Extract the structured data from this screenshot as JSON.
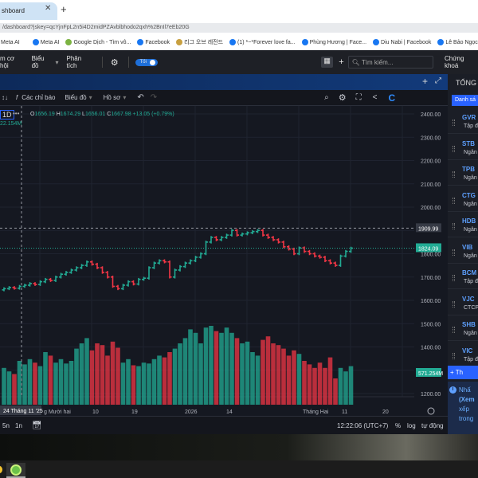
{
  "browser": {
    "tab_title": "shboard",
    "url": "/dashboard?jskey=qcYjnFpL2n5i4D2midPZAvblbhodo2qxh%2BnIl7eEb20G",
    "bookmarks": [
      "Meta AI",
      "Meta AI",
      "Google Dịch - Tìm vô...",
      "Facebook",
      "리그 오브 레전드",
      "(1) *~*Forever love fa...",
      "Phùng Hương | Face...",
      "Diu Nabi | Facebook",
      "Lê Bảo Ngọc | Face"
    ]
  },
  "nav": {
    "items": [
      "m cơ hội",
      "Biểu đồ",
      "Phân tích"
    ],
    "toggle_label": "Tối",
    "search_placeholder": "Tìm kiếm...",
    "right_label": "Chứng khoá"
  },
  "toolbar": {
    "indicators": "Các chỉ báo",
    "chart": "Biểu đồ",
    "profile": "Hồ sơ"
  },
  "legend": {
    "interval": "1D",
    "open_label": "O",
    "open": "1656.19",
    "high_label": "H",
    "high": "1674.29",
    "low_label": "L",
    "low": "1656.01",
    "close_label": "C",
    "close": "1667.98",
    "change": "+13.05 (+0.79%)",
    "volume": "22.154M"
  },
  "price_labels": {
    "crosshair": "1909.99",
    "last": "1824.09",
    "volume_last": "571.254M"
  },
  "time_axis": {
    "crosshair_date": "24 Tháng 11 '25",
    "ticks": [
      "g Mười hai",
      "10",
      "19",
      "2026",
      "14",
      "Tháng Hai",
      "11",
      "20"
    ]
  },
  "bottombar": {
    "ranges": [
      "5n",
      "1n"
    ],
    "time": "12:22:06 (UTC+7)",
    "percent": "%",
    "log": "log",
    "auto": "tự động"
  },
  "panel": {
    "title": "TỔNG",
    "tab": "Danh sá",
    "watchlist": [
      {
        "s": "GVR",
        "d": "Tập đ"
      },
      {
        "s": "STB",
        "d": "Ngân"
      },
      {
        "s": "TPB",
        "d": "Ngân"
      },
      {
        "s": "CTG",
        "d": "Ngân"
      },
      {
        "s": "HDB",
        "d": "Ngân"
      },
      {
        "s": "VIB",
        "d": "Ngân"
      },
      {
        "s": "BCM",
        "d": "Tập đ"
      },
      {
        "s": "VJC",
        "d": "CTCP"
      },
      {
        "s": "SHB",
        "d": "Ngân"
      },
      {
        "s": "VIC",
        "d": "Tập đ"
      }
    ],
    "add": "+ Th",
    "note": [
      "Nhấ",
      "(Xem",
      "xếp",
      "trong"
    ]
  },
  "colors": {
    "up": "#22ab94",
    "down": "#f23645",
    "bg": "#151821",
    "accent": "#2962ff"
  },
  "chart_data": {
    "type": "ohlc",
    "yticks": [
      2400,
      2300,
      2200,
      2100,
      2000,
      1900,
      1800,
      1700,
      1600,
      1500,
      1400,
      1300,
      1200
    ],
    "ytick_labels": [
      "2400.00",
      "2300.00",
      "2200.00",
      "2100.00",
      "2000.00",
      "1909.99",
      "1800.00",
      "1700.00",
      "1600.00",
      "1500.00",
      "1400.00",
      "1300.00",
      "1200.00"
    ],
    "ylim": [
      1175,
      2430
    ],
    "close": [
      1650,
      1655,
      1652,
      1660,
      1665,
      1672,
      1668,
      1680,
      1690,
      1685,
      1700,
      1712,
      1720,
      1730,
      1740,
      1750,
      1765,
      1755,
      1740,
      1720,
      1700,
      1660,
      1650,
      1665,
      1680,
      1670,
      1690,
      1695,
      1740,
      1760,
      1770,
      1765,
      1700,
      1730,
      1745,
      1760,
      1770,
      1785,
      1800,
      1850,
      1870,
      1860,
      1870,
      1880,
      1900,
      1880,
      1885,
      1890,
      1895,
      1900,
      1880,
      1870,
      1860,
      1850,
      1830,
      1820,
      1800,
      1825,
      1810,
      1800,
      1790,
      1785,
      1770,
      1760,
      1750,
      1790,
      1810,
      1824
    ],
    "volume_m": [
      420,
      380,
      350,
      500,
      460,
      520,
      480,
      440,
      600,
      560,
      480,
      520,
      470,
      500,
      640,
      700,
      760,
      620,
      700,
      680,
      560,
      720,
      650,
      480,
      520,
      450,
      440,
      480,
      470,
      520,
      560,
      540,
      600,
      640,
      700,
      760,
      860,
      820,
      700,
      880,
      900,
      840,
      820,
      880,
      820,
      760,
      700,
      720,
      600,
      560,
      740,
      780,
      700,
      680,
      640,
      560,
      620,
      580,
      500,
      460,
      420,
      480,
      420,
      540,
      300,
      420,
      380,
      440
    ]
  }
}
